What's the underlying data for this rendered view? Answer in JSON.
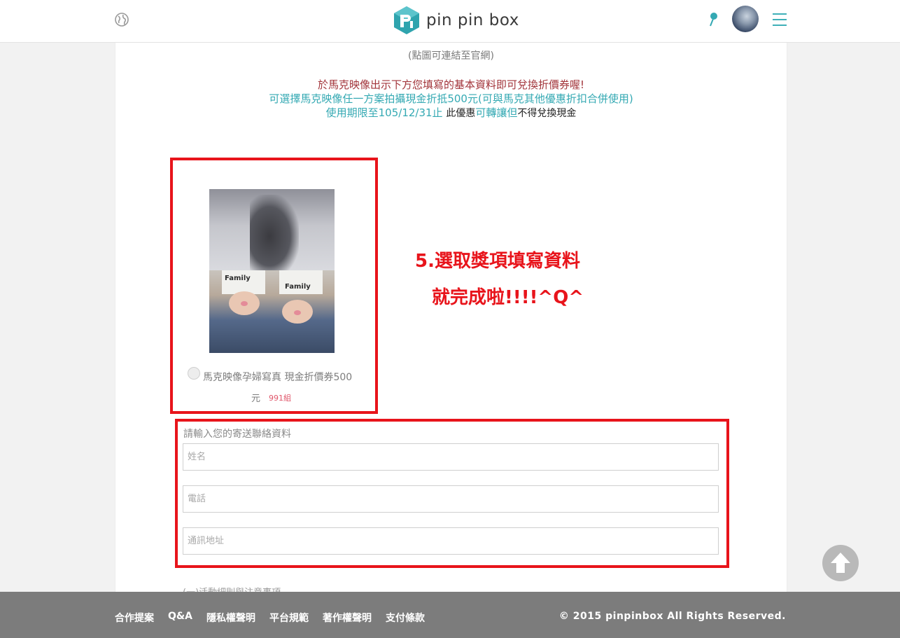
{
  "header": {
    "logo_text": "pin pin box",
    "icons": [
      "globe-icon",
      "pin-icon",
      "avatar",
      "menu-icon"
    ]
  },
  "content": {
    "link_note": "(點圖可連結至官網)",
    "line1": "於馬克映像出示下方您填寫的基本資料即可兌換折價券喔!",
    "line2": "可選擇馬克映像任一方案拍攝現金折抵500元(可與馬克其他優惠折扣合併使用)",
    "line3_a": "使用期限至105/12/31止 ",
    "line3_b": "此優惠",
    "line3_c": "可轉讓",
    "line3_d": "但",
    "line3_e": "不得兌換現金"
  },
  "prize": {
    "photo_top_text": "Family",
    "photo_bot_text": "Family",
    "name_line1": "馬克映像孕婦寫真 現金折價券500",
    "name_line2": "元",
    "count": "991組"
  },
  "annotation": {
    "line1": "5.選取獎項填寫資料",
    "line2": "就完成啦!!!!^Q^"
  },
  "form": {
    "title": "請輸入您的寄送聯絡資料",
    "name_placeholder": "姓名",
    "phone_placeholder": "電話",
    "address_placeholder": "通訊地址"
  },
  "notice": "(一)活動細則與注意事項",
  "footer": {
    "links": [
      "合作提案",
      "Q&A",
      "隱私權聲明",
      "平台規範",
      "著作權聲明",
      "支付條款"
    ],
    "copyright": "© 2015 pinpinbox All Rights Reserved."
  },
  "colors": {
    "brand_teal": "#34a9b3",
    "annotation_red": "#e8141b",
    "footer_gray": "#7c7c7c"
  }
}
